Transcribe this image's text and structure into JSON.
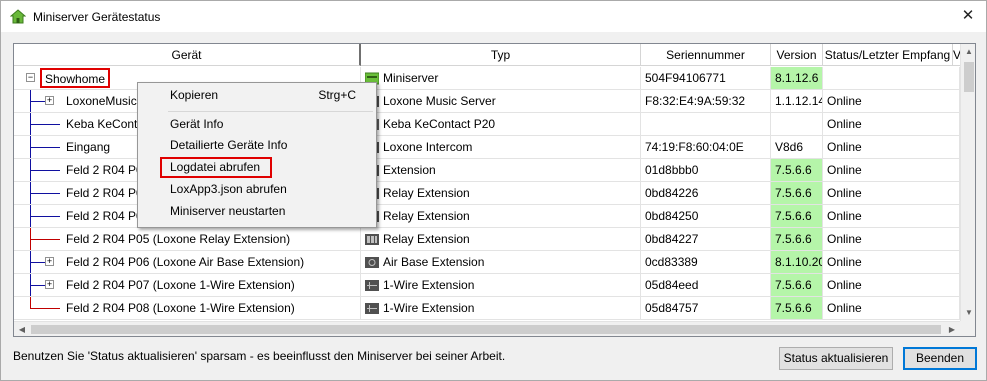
{
  "window": {
    "title": "Miniserver Gerätestatus",
    "close_glyph": "✕"
  },
  "columns": [
    "Gerät",
    "Typ",
    "Seriennummer",
    "Version",
    "Status/Letzter Empfang",
    "V"
  ],
  "rows": [
    {
      "device": "Showhome",
      "type": "Miniserver",
      "serial": "504F94106771",
      "version": "8.1.12.6",
      "status": "",
      "version_highlight": true,
      "expander": "⊟",
      "selected": true,
      "icon": "miniserver-icon"
    },
    {
      "device": "LoxoneMusic",
      "type": "Loxone Music Server",
      "serial": "F8:32:E4:9A:59:32",
      "version": "1.1.12.14",
      "status": "Online",
      "version_highlight": false,
      "expander": "⊞",
      "icon": "music-server-icon"
    },
    {
      "device": "Keba KeCont",
      "type": "Keba KeContact P20",
      "serial": "",
      "version": "",
      "status": "Online",
      "version_highlight": false,
      "icon": "keba-icon"
    },
    {
      "device": "Eingang",
      "type": "Loxone Intercom",
      "serial": "74:19:F8:60:04:0E",
      "version": "V8d6",
      "status": "Online",
      "version_highlight": false,
      "icon": "intercom-icon"
    },
    {
      "device": "Feld 2 R04 P0",
      "type": "Extension",
      "serial": "01d8bbb0",
      "version": "7.5.6.6",
      "status": "Online",
      "version_highlight": true,
      "icon": "extension-icon"
    },
    {
      "device": "Feld 2 R04 P0",
      "type": "Relay Extension",
      "serial": "0bd84226",
      "version": "7.5.6.6",
      "status": "Online",
      "version_highlight": true,
      "icon": "relay-extension-icon"
    },
    {
      "device": "Feld 2 R04 P0",
      "type": "Relay Extension",
      "serial": "0bd84250",
      "version": "7.5.6.6",
      "status": "Online",
      "version_highlight": true,
      "icon": "relay-extension-icon"
    },
    {
      "device": "Feld 2 R04 P05 (Loxone Relay Extension)",
      "type": "Relay Extension",
      "serial": "0bd84227",
      "version": "7.5.6.6",
      "status": "Online",
      "version_highlight": true,
      "icon": "relay-extension-icon"
    },
    {
      "device": "Feld 2 R04 P06 (Loxone Air Base Extension)",
      "type": "Air Base Extension",
      "serial": "0cd83389",
      "version": "8.1.10.20",
      "status": "Online",
      "version_highlight": true,
      "expander": "⊞",
      "icon": "air-base-extension-icon"
    },
    {
      "device": "Feld 2 R04 P07 (Loxone 1-Wire Extension)",
      "type": "1-Wire Extension",
      "serial": "05d84eed",
      "version": "7.5.6.6",
      "status": "Online",
      "version_highlight": true,
      "expander": "⊞",
      "icon": "onewire-extension-icon"
    },
    {
      "device": "Feld 2 R04 P08 (Loxone 1-Wire Extension)",
      "type": "1-Wire Extension",
      "serial": "05d84757",
      "version": "7.5.6.6",
      "status": "Online",
      "version_highlight": true,
      "icon": "onewire-extension-icon"
    }
  ],
  "context_menu": {
    "items": [
      {
        "label": "Kopieren",
        "shortcut": "Strg+C"
      },
      {
        "label": "Gerät Info"
      },
      {
        "label": "Detailierte Geräte Info"
      },
      {
        "label": "Logdatei abrufen",
        "highlighted": true
      },
      {
        "label": "LoxApp3.json abrufen"
      },
      {
        "label": "Miniserver neustarten"
      }
    ]
  },
  "footer": {
    "message": "Benutzen Sie 'Status aktualisieren' sparsam - es beeinflusst den Miniserver bei seiner Arbeit.",
    "refresh_label": "Status aktualisieren",
    "close_label": "Beenden"
  },
  "colors": {
    "version_green": "#b5f5a9",
    "highlight_red": "#e00000",
    "miniserver_green": "#6abf3a",
    "tree_line_blue": "#1010a0",
    "tree_line_red": "#c00000"
  }
}
